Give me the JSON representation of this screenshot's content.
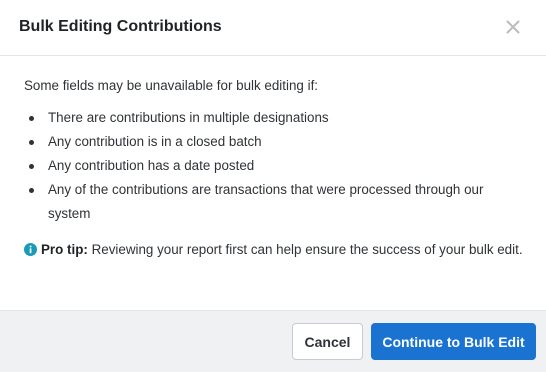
{
  "dialog": {
    "title": "Bulk Editing Contributions",
    "close_icon": "close-icon"
  },
  "body": {
    "intro": "Some fields may be unavailable for bulk editing if:",
    "conditions": [
      "There are contributions in multiple designations",
      "Any contribution is in a closed batch",
      "Any contribution has a date posted",
      "Any of the contributions are transactions that were processed through our system"
    ],
    "tip": {
      "icon": "info-icon",
      "label": "Pro tip:",
      "text": " Reviewing your report first can help ensure the success of your bulk edit."
    }
  },
  "footer": {
    "cancel_label": "Cancel",
    "continue_label": "Continue to Bulk Edit"
  },
  "colors": {
    "primary": "#1a73d1",
    "info": "#1a9bb5",
    "footer_bg": "#f0f1f3"
  }
}
